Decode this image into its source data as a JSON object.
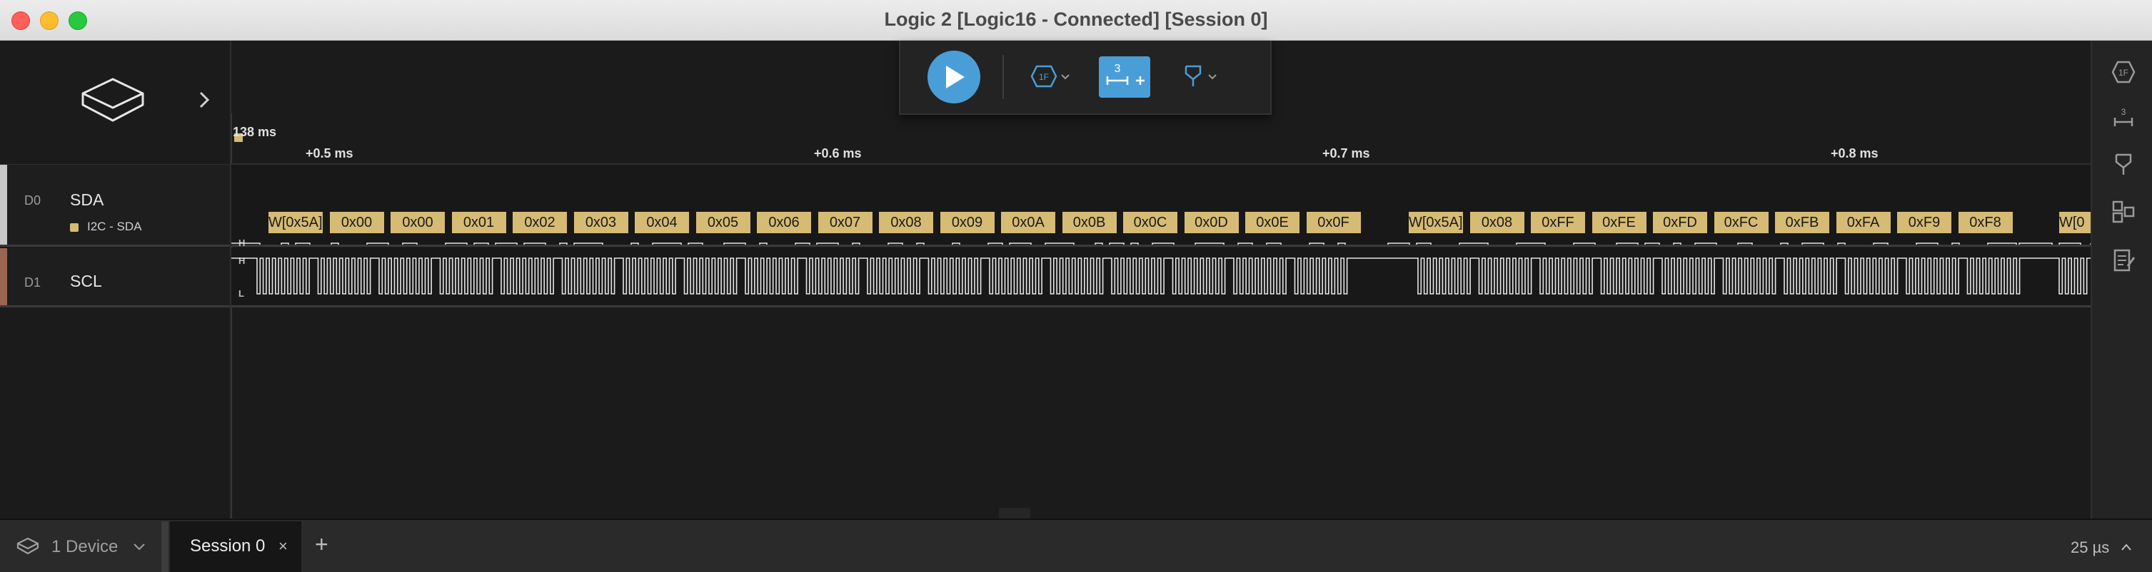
{
  "window": {
    "title": "Logic 2 [Logic16 - Connected] [Session 0]"
  },
  "colors": {
    "accent": "#4a9ed8",
    "decoder": "#d6bb74",
    "start_marker": "#33a84c",
    "stop_marker": "#e57b32",
    "d0_strip": "#c8c8c8",
    "d1_strip": "#9b6650"
  },
  "toolbar": {
    "play_icon": "play-icon",
    "trigger_icon": "trigger-hex-icon",
    "measure_icon": "measure-icon",
    "measure_badge": "3",
    "marker_icon": "marker-flag-icon"
  },
  "timeline": {
    "absolute_label": "138 ms",
    "ticks": [
      "+0.5 ms",
      "+0.6 ms",
      "+0.7 ms",
      "+0.8 ms"
    ]
  },
  "channels": [
    {
      "num": "D0",
      "name": "SDA",
      "analyzer": "I2C - SDA",
      "high": "H",
      "low": "L"
    },
    {
      "num": "D1",
      "name": "SCL",
      "high": "H",
      "low": "L"
    }
  ],
  "decoded": [
    "W[0x5A]",
    "0x00",
    "0x00",
    "0x01",
    "0x02",
    "0x03",
    "0x04",
    "0x05",
    "0x06",
    "0x07",
    "0x08",
    "0x09",
    "0x0A",
    "0x0B",
    "0x0C",
    "0x0D",
    "0x0E",
    "0x0F",
    "W[0x5A]",
    "0x08",
    "0xFF",
    "0xFE",
    "0xFD",
    "0xFC",
    "0xFB",
    "0xFA",
    "0xF9",
    "0xF8",
    "W[0"
  ],
  "right_rail": [
    "trigger-hex-icon",
    "measure-icon",
    "marker-flag-icon",
    "extensions-icon",
    "notes-icon"
  ],
  "bottom": {
    "device_label": "1 Device",
    "session_tab": "Session 0",
    "close_glyph": "×",
    "add_glyph": "+",
    "zoom": "25 µs"
  }
}
